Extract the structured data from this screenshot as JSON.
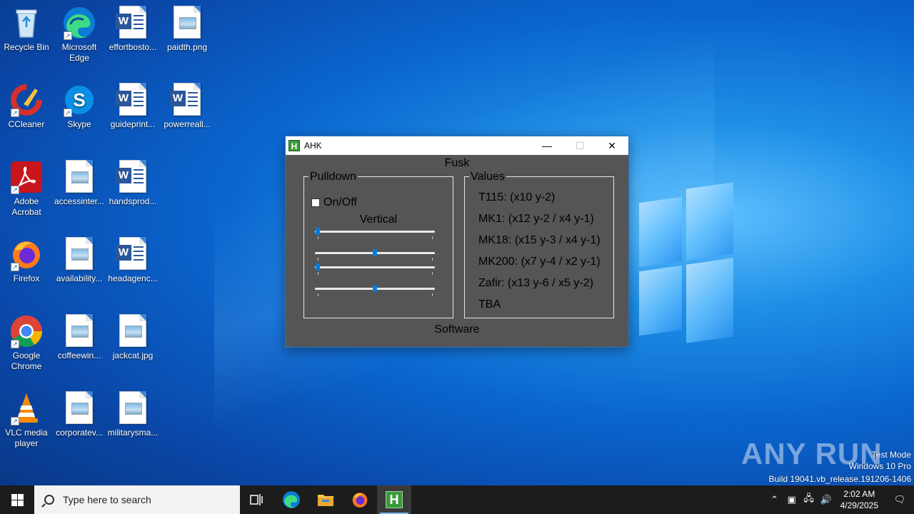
{
  "desktop": {
    "icons": [
      {
        "label": "Recycle Bin",
        "icon": "recycle-bin-icon"
      },
      {
        "label": "Microsoft Edge",
        "icon": "edge-icon"
      },
      {
        "label": "effortbosto...",
        "icon": "word-doc-icon"
      },
      {
        "label": "paidth.png",
        "icon": "image-file-icon"
      },
      {
        "label": "CCleaner",
        "icon": "ccleaner-icon"
      },
      {
        "label": "Skype",
        "icon": "skype-icon"
      },
      {
        "label": "guideprint...",
        "icon": "word-doc-icon"
      },
      {
        "label": "powerreall...",
        "icon": "word-doc-icon"
      },
      {
        "label": "Adobe Acrobat",
        "icon": "acrobat-icon"
      },
      {
        "label": "accessinter...",
        "icon": "image-file-icon"
      },
      {
        "label": "handsprod...",
        "icon": "word-doc-icon"
      },
      {
        "label": "Firefox",
        "icon": "firefox-icon"
      },
      {
        "label": "availability...",
        "icon": "image-file-icon"
      },
      {
        "label": "headagenc...",
        "icon": "word-doc-icon"
      },
      {
        "label": "Google Chrome",
        "icon": "chrome-icon"
      },
      {
        "label": "coffeewin...",
        "icon": "image-file-icon"
      },
      {
        "label": "jackcat.jpg",
        "icon": "image-file-icon"
      },
      {
        "label": "VLC media player",
        "icon": "vlc-icon"
      },
      {
        "label": "corporatev...",
        "icon": "image-file-icon"
      },
      {
        "label": "militarysma...",
        "icon": "image-file-icon"
      }
    ]
  },
  "window": {
    "app_icon_letter": "H",
    "title": "AHK",
    "minimize": "—",
    "maximize": "☐",
    "close": "✕",
    "heading": "Fusk",
    "footer": "Software",
    "pulldown": {
      "legend": "Pulldown",
      "checkbox_label": "On/Off",
      "checked": false,
      "sub_label": "Vertical",
      "sliders": [
        {
          "value": 0
        },
        {
          "value": 0.5
        },
        {
          "value": 0
        },
        {
          "value": 0.5
        }
      ]
    },
    "values": {
      "legend": "Values",
      "items": [
        "T115: (x10 y-2)",
        "MK1: (x12 y-2 / x4 y-1)",
        "MK18: (x15 y-3 / x4 y-1)",
        "MK200: (x7 y-4 / x2 y-1)",
        "Zafir: (x13 y-6 / x5 y-2)",
        "TBA"
      ]
    }
  },
  "taskbar": {
    "search_placeholder": "Type here to search",
    "time": "2:02 AM",
    "date": "4/29/2025",
    "apps": [
      "task-view-icon",
      "edge-icon",
      "file-explorer-icon",
      "firefox-icon",
      "ahk-icon"
    ]
  },
  "watermark": {
    "brand": "ANY RUN",
    "line1": "Test Mode",
    "line2": "Windows 10 Pro",
    "line3": "Build 19041.vb_release.191206-1406"
  }
}
